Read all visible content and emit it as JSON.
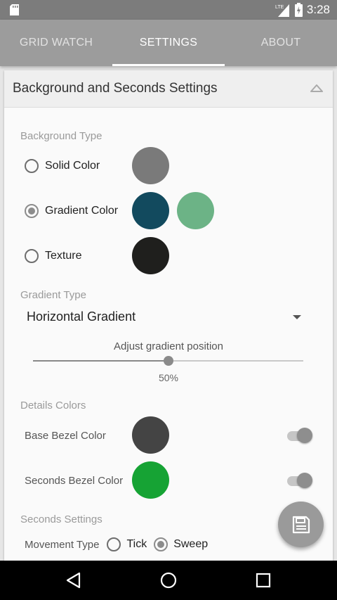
{
  "status_bar": {
    "time": "3:28",
    "network_type": "LTE",
    "icons": [
      "sd-card-icon",
      "signal-icon",
      "battery-icon"
    ]
  },
  "tabs": [
    {
      "label": "GRID WATCH",
      "active": false
    },
    {
      "label": "SETTINGS",
      "active": true
    },
    {
      "label": "ABOUT",
      "active": false
    }
  ],
  "card": {
    "title": "Background and Seconds Settings",
    "collapse_icon": "chevron-up-icon"
  },
  "background_type": {
    "label": "Background Type",
    "options": [
      {
        "label": "Solid Color",
        "selected": false,
        "colors": [
          "#7a7a7a"
        ]
      },
      {
        "label": "Gradient Color",
        "selected": true,
        "colors": [
          "#124a5e",
          "#6cb386"
        ]
      },
      {
        "label": "Texture",
        "selected": false,
        "colors": [
          "#1f1f1d"
        ]
      }
    ]
  },
  "gradient_type": {
    "label": "Gradient Type",
    "selected": "Horizontal Gradient"
  },
  "gradient_position": {
    "label": "Adjust gradient position",
    "value_text": "50%",
    "value": 0.5
  },
  "details_colors": {
    "label": "Details Colors",
    "items": [
      {
        "label": "Base Bezel Color",
        "color": "#444444",
        "enabled": true
      },
      {
        "label": "Seconds Bezel Color",
        "color": "#16a334",
        "enabled": true
      }
    ]
  },
  "seconds_settings": {
    "label": "Seconds Settings",
    "movement_label": "Movement Type",
    "options": [
      {
        "label": "Tick",
        "selected": false
      },
      {
        "label": "Sweep",
        "selected": true
      }
    ]
  },
  "fab": {
    "icon": "save-icon"
  },
  "nav": {
    "icons": [
      "back-icon",
      "home-icon",
      "recents-icon"
    ]
  }
}
